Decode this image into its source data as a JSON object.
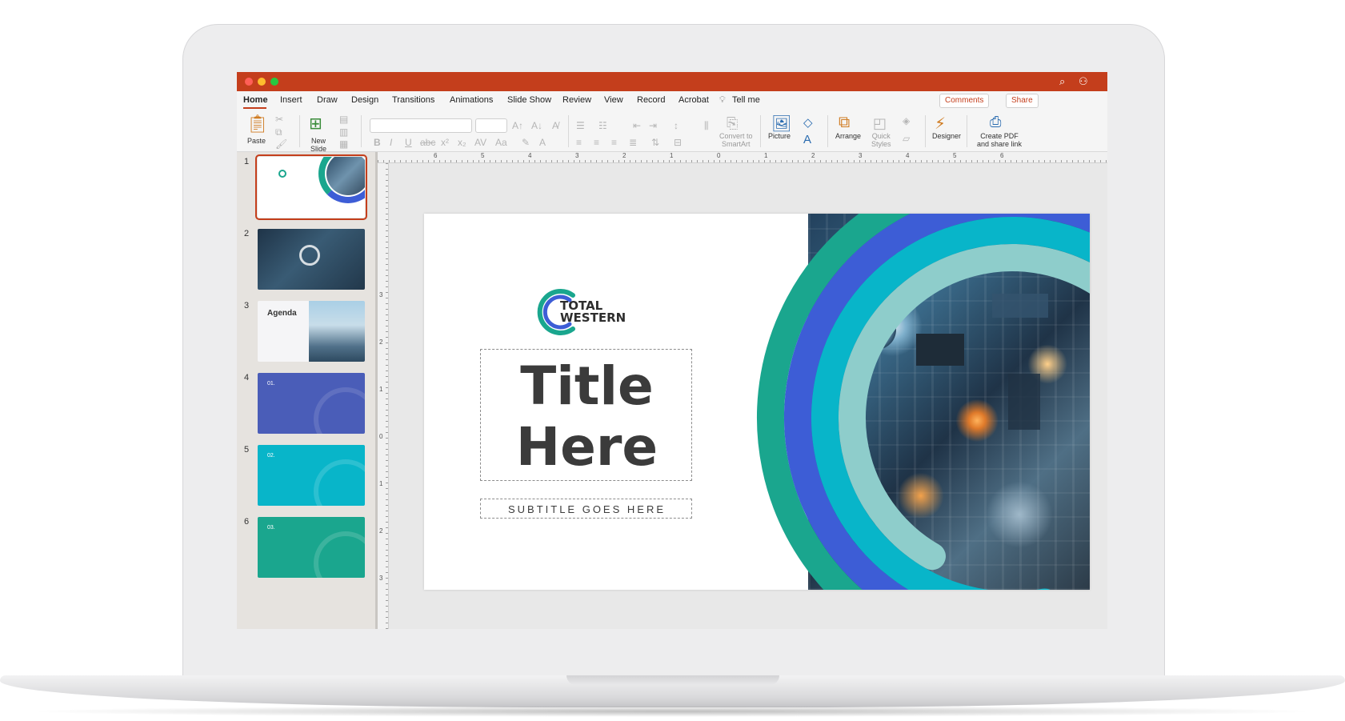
{
  "window": {
    "titlebar_color": "#c43e1c",
    "traffic_lights": [
      "#ff5f57",
      "#febc2e",
      "#28c840"
    ]
  },
  "ribbon": {
    "tabs": [
      "Home",
      "Insert",
      "Draw",
      "Design",
      "Transitions",
      "Animations",
      "Slide Show",
      "Review",
      "View",
      "Record",
      "Acrobat",
      "Tell me"
    ],
    "active_tab": "Home",
    "comments_label": "Comments",
    "share_label": "Share"
  },
  "toolbar": {
    "paste_label": "Paste",
    "new_slide_label": "New\nSlide",
    "convert_label": "Convert to\nSmartArt",
    "picture_label": "Picture",
    "arrange_label": "Arrange",
    "quick_styles_label": "Quick\nStyles",
    "designer_label": "Designer",
    "create_pdf_label": "Create PDF\nand share link"
  },
  "ruler": {
    "h_ticks": [
      "6",
      "5",
      "4",
      "3",
      "2",
      "1",
      "0",
      "1",
      "2",
      "3",
      "4",
      "5",
      "6"
    ],
    "v_ticks": [
      "3",
      "2",
      "1",
      "0",
      "1",
      "2",
      "3"
    ]
  },
  "thumbnails": [
    {
      "number": "1",
      "label": ""
    },
    {
      "number": "2",
      "label": ""
    },
    {
      "number": "3",
      "label": "Agenda"
    },
    {
      "number": "4",
      "label": "01."
    },
    {
      "number": "5",
      "label": "02."
    },
    {
      "number": "6",
      "label": "03."
    }
  ],
  "slide": {
    "logo_line1": "TOTAL",
    "logo_line2": "WESTERN",
    "title_line1": "Title",
    "title_line2": "Here",
    "subtitle": "SUBTITLE GOES HERE",
    "arc_colors": [
      "#1aa68e",
      "#3d5dd6",
      "#08b5c9",
      "#8ecdcb"
    ]
  }
}
